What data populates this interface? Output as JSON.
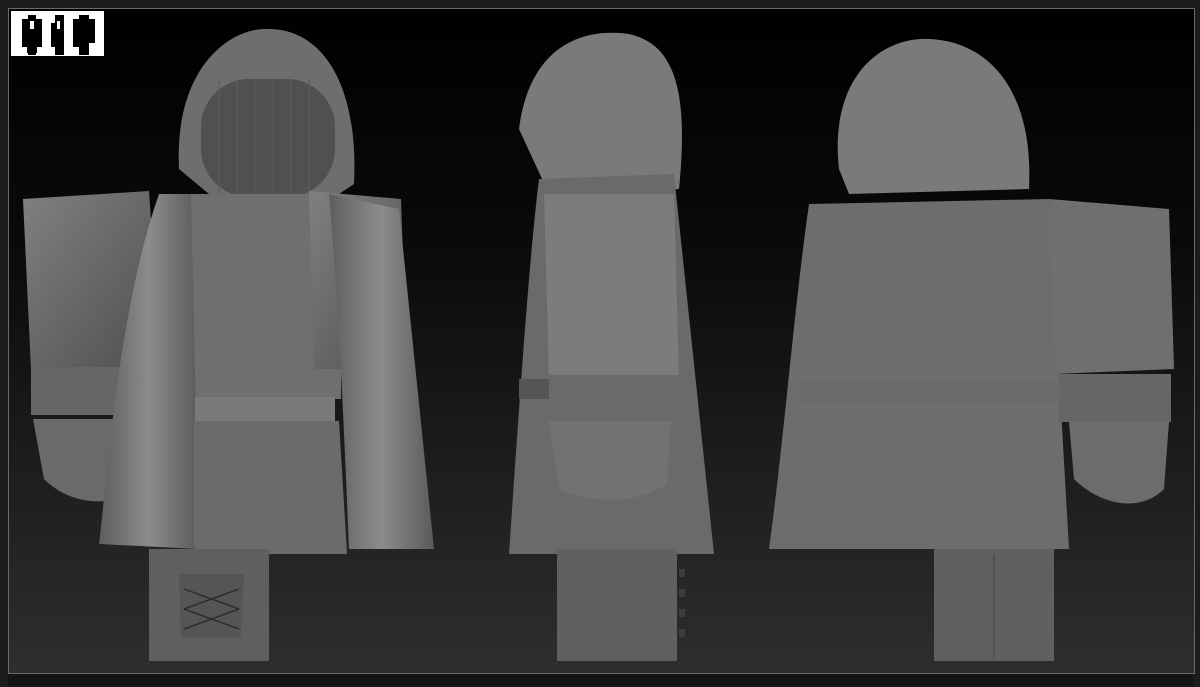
{
  "app": {
    "window_label": "",
    "view_count": 3
  },
  "views": [
    {
      "id": "front",
      "label": ""
    },
    {
      "id": "side",
      "label": ""
    },
    {
      "id": "back",
      "label": ""
    }
  ],
  "colors": {
    "viewport_top": "#000000",
    "viewport_bottom": "#2e2e2e",
    "clay": "#7b7b7b",
    "clay_light": "#9a9a9a",
    "clay_dark": "#4a4a4a",
    "frame": "#6a6a6a",
    "widget_bg": "#ffffff"
  },
  "icons": {
    "view_widget": "figure-views-icon"
  }
}
